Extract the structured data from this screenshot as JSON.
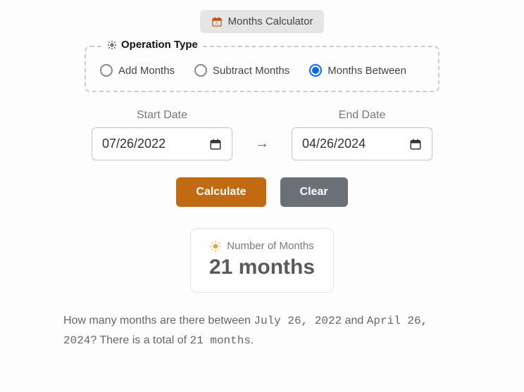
{
  "badge": {
    "label": "Months Calculator"
  },
  "operation": {
    "legend": "Operation Type",
    "options": [
      {
        "label": "Add Months"
      },
      {
        "label": "Subtract Months"
      },
      {
        "label": "Months Between"
      }
    ],
    "selected_index": 2
  },
  "dates": {
    "start_label": "Start Date",
    "start_value": "07/26/2022",
    "end_label": "End Date",
    "end_value": "04/26/2024"
  },
  "buttons": {
    "calculate": "Calculate",
    "clear": "Clear"
  },
  "result": {
    "title": "Number of Months",
    "value": "21 months"
  },
  "summary": {
    "prefix": "How many months are there between ",
    "date1": "July 26, 2022",
    "mid": " and ",
    "date2": "April 26, 2024",
    "q": "? There is a total of ",
    "total": "21 months",
    "suffix": "."
  }
}
